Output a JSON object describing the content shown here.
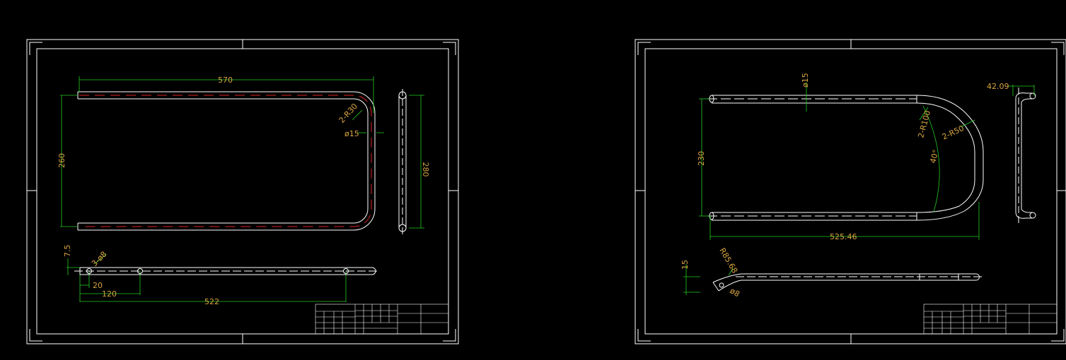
{
  "colors": {
    "background": "#000000",
    "border": "#ffffff",
    "dimension_line": "#22cc22",
    "dimension_text": "#d8a440",
    "centerline": "#dd2222"
  },
  "sheet1": {
    "dims": {
      "length": "570",
      "height_left": "260",
      "height_right": "280",
      "bend_radius": "2-R30",
      "tube_dia": "ø15",
      "offset": "7.5",
      "holes": "3-ø8",
      "hole_pos1": "20",
      "hole_pos2": "120",
      "hole_pos3": "522"
    }
  },
  "sheet2": {
    "dims": {
      "tube_dia": "ø15",
      "height": "230",
      "bend_large": "2-R100",
      "bend_small": "2-R50",
      "angle": "40°",
      "length": "525.46",
      "side_width": "42.09",
      "end_bend": "R85.68",
      "hole": "ø8",
      "end_height": "15"
    }
  }
}
